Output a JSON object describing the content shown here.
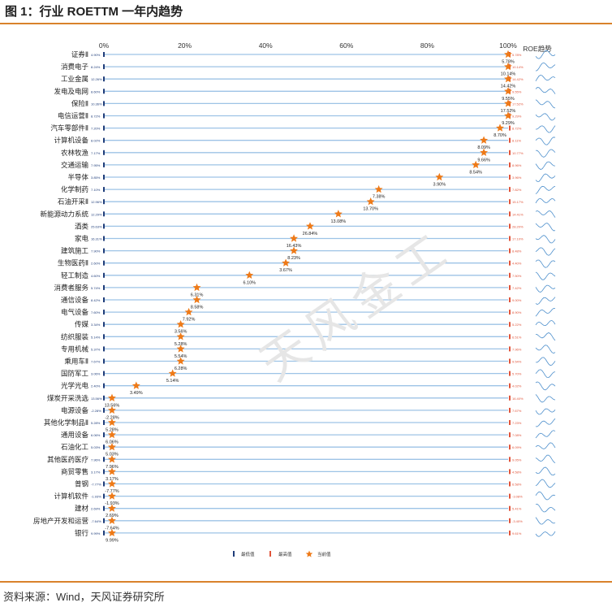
{
  "title": "图 1：行业 ROETTM 一年内趋势",
  "source": "资料来源：Wind，天风证券研究所",
  "watermark": "天风金工",
  "colors": {
    "rule": "#d9822b",
    "line": "#9dc3e6",
    "min_marker": "#1f3d7a",
    "max_marker": "#e0543a",
    "star": "#ee7a18",
    "spark": "#4d8fcc",
    "max_text": "#e0543a",
    "min_text": "#1f3d7a"
  },
  "chart_data": {
    "type": "dot-range",
    "xlim": [
      0,
      100
    ],
    "x_ticks": [
      "0%",
      "20%",
      "40%",
      "60%",
      "80%",
      "100%"
    ],
    "trend_header": "ROE趋势",
    "legend": [
      "最低值",
      "最高值",
      "当前值"
    ],
    "rows": [
      {
        "name": "证券Ⅱ",
        "current_pct": 100,
        "min_label": "4.90%",
        "max_label": "5.78%",
        "current_label": "5.78%"
      },
      {
        "name": "消费电子",
        "current_pct": 100,
        "min_label": "8.24%",
        "max_label": "10.14%",
        "current_label": "10.14%"
      },
      {
        "name": "工业金属",
        "current_pct": 100,
        "min_label": "12.26%",
        "max_label": "14.42%",
        "current_label": "14.42%"
      },
      {
        "name": "发电及电网",
        "current_pct": 100,
        "min_label": "8.60%",
        "max_label": "9.55%",
        "current_label": "9.55%"
      },
      {
        "name": "保险Ⅱ",
        "current_pct": 100,
        "min_label": "10.36%",
        "max_label": "17.52%",
        "current_label": "17.52%"
      },
      {
        "name": "电信运营Ⅱ",
        "current_pct": 100,
        "min_label": "8.72%",
        "max_label": "9.29%",
        "current_label": "9.29%"
      },
      {
        "name": "汽车零部件Ⅱ",
        "current_pct": 98,
        "min_label": "7.20%",
        "max_label": "8.72%",
        "current_label": "8.70%"
      },
      {
        "name": "计算机设备",
        "current_pct": 94,
        "min_label": "8.02%",
        "max_label": "8.11%",
        "current_label": "8.09%"
      },
      {
        "name": "农林牧渔",
        "current_pct": 94,
        "min_label": "7.17%",
        "max_label": "10.77%",
        "current_label": "9.66%"
      },
      {
        "name": "交通运输",
        "current_pct": 92,
        "min_label": "7.95%",
        "max_label": "8.96%",
        "current_label": "8.54%"
      },
      {
        "name": "半导体",
        "current_pct": 83,
        "min_label": "3.85%",
        "max_label": "3.96%",
        "current_label": "3.90%"
      },
      {
        "name": "化学制药",
        "current_pct": 68,
        "min_label": "7.10%",
        "max_label": "7.82%",
        "current_label": "7.38%"
      },
      {
        "name": "石油开采Ⅱ",
        "current_pct": 66,
        "min_label": "12.96%",
        "max_label": "15.17%",
        "current_label": "13.70%"
      },
      {
        "name": "新能源动力系统",
        "current_pct": 58,
        "min_label": "12.29%",
        "max_label": "14.41%",
        "current_label": "13.08%"
      },
      {
        "name": "酒类",
        "current_pct": 51,
        "min_label": "25.63%",
        "max_label": "28.20%",
        "current_label": "26.84%"
      },
      {
        "name": "家电",
        "current_pct": 47,
        "min_label": "16.31%",
        "max_label": "17.10%",
        "current_label": "16.43%"
      },
      {
        "name": "建筑施工",
        "current_pct": 47,
        "min_label": "7.90%",
        "max_label": "8.48%",
        "current_label": "8.23%"
      },
      {
        "name": "生物医药Ⅱ",
        "current_pct": 45,
        "min_label": "2.60%",
        "max_label": "4.40%",
        "current_label": "3.67%"
      },
      {
        "name": "轻工制造",
        "current_pct": 36,
        "min_label": "4.60%",
        "max_label": "7.50%",
        "current_label": "6.10%"
      },
      {
        "name": "消费者服务",
        "current_pct": 23,
        "min_label": "5.74%",
        "max_label": "7.42%",
        "current_label": "6.31%"
      },
      {
        "name": "通信设备",
        "current_pct": 23,
        "min_label": "8.42%",
        "max_label": "9.00%",
        "current_label": "8.58%"
      },
      {
        "name": "电气设备",
        "current_pct": 21,
        "min_label": "7.60%",
        "max_label": "8.90%",
        "current_label": "7.92%"
      },
      {
        "name": "传媒",
        "current_pct": 19,
        "min_label": "3.34%",
        "max_label": "5.22%",
        "current_label": "3.56%"
      },
      {
        "name": "纺织服装",
        "current_pct": 19,
        "min_label": "5.14%",
        "max_label": "6.51%",
        "current_label": "5.28%"
      },
      {
        "name": "专用机械",
        "current_pct": 19,
        "min_label": "5.37%",
        "max_label": "7.96%",
        "current_label": "5.54%"
      },
      {
        "name": "乘用车Ⅱ",
        "current_pct": 19,
        "min_label": "7.67%",
        "max_label": "9.54%",
        "current_label": "6.28%"
      },
      {
        "name": "国防军工",
        "current_pct": 17,
        "min_label": "3.06%",
        "max_label": "5.70%",
        "current_label": "5.14%"
      },
      {
        "name": "光学光电",
        "current_pct": 8,
        "min_label": "2.40%",
        "max_label": "4.02%",
        "current_label": "3.49%"
      },
      {
        "name": "煤炭开采洗选",
        "current_pct": 2,
        "min_label": "13.56%",
        "max_label": "16.40%",
        "current_label": "13.56%"
      },
      {
        "name": "电源设备",
        "current_pct": 2,
        "min_label": "-2.28%",
        "max_label": "7.67%",
        "current_label": "-2.28%"
      },
      {
        "name": "其他化学制品Ⅱ",
        "current_pct": 2,
        "min_label": "5.28%",
        "max_label": "7.23%",
        "current_label": "5.28%"
      },
      {
        "name": "通用设备",
        "current_pct": 2,
        "min_label": "6.06%",
        "max_label": "7.08%",
        "current_label": "6.06%"
      },
      {
        "name": "石油化工",
        "current_pct": 2,
        "min_label": "5.03%",
        "max_label": "6.09%",
        "current_label": "5.03%"
      },
      {
        "name": "其他医药医疗",
        "current_pct": 2,
        "min_label": "7.96%",
        "max_label": "9.05%",
        "current_label": "7.96%"
      },
      {
        "name": "商贸零售",
        "current_pct": 2,
        "min_label": "3.17%",
        "max_label": "4.58%",
        "current_label": "3.17%"
      },
      {
        "name": "普钢",
        "current_pct": 2,
        "min_label": "-7.77%",
        "max_label": "6.58%",
        "current_label": "-7.77%"
      },
      {
        "name": "计算机软件",
        "current_pct": 2,
        "min_label": "-1.93%",
        "max_label": "-3.08%",
        "current_label": "-1.93%"
      },
      {
        "name": "建材",
        "current_pct": 2,
        "min_label": "2.69%",
        "max_label": "5.41%",
        "current_label": "2.69%"
      },
      {
        "name": "房地产开发和运营",
        "current_pct": 2,
        "min_label": "-7.64%",
        "max_label": "-3.40%",
        "current_label": "-7.64%"
      },
      {
        "name": "银行",
        "current_pct": 2,
        "min_label": "9.99%",
        "max_label": "9.61%",
        "current_label": "9.99%"
      }
    ]
  }
}
